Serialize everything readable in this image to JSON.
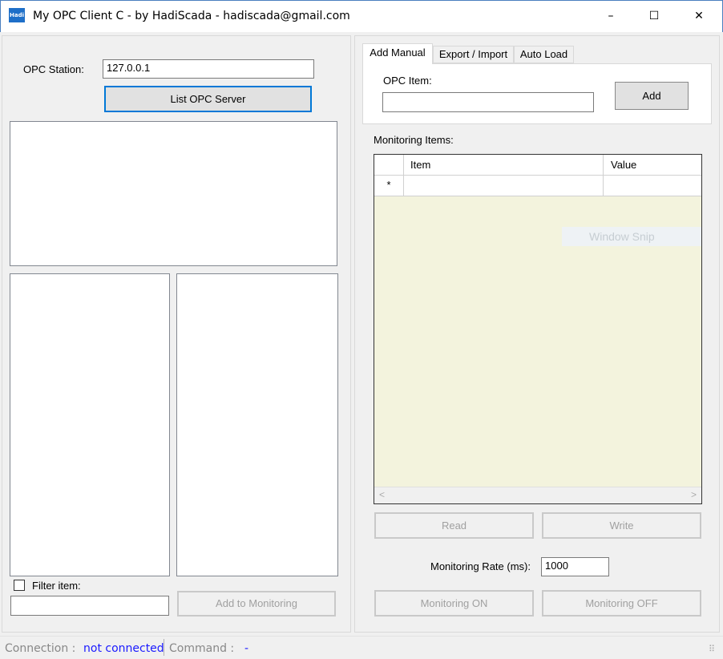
{
  "window": {
    "title": "My OPC Client C - by HadiScada - hadiscada@gmail.com",
    "icon_text": "Hadi",
    "minimize": "–",
    "maximize": "☐",
    "close": "✕"
  },
  "left": {
    "station_label": "OPC Station:",
    "station_value": "127.0.0.1",
    "list_button": "List OPC Server",
    "filter_label": "Filter item:",
    "filter_value": "",
    "add_button": "Add to Monitoring"
  },
  "tabs": [
    "Add Manual",
    "Export / Import",
    "Auto Load"
  ],
  "manual": {
    "opc_item_label": "OPC Item:",
    "opc_item_value": "",
    "add_button": "Add"
  },
  "monitoring": {
    "label": "Monitoring Items:",
    "columns": [
      "Item",
      "Value"
    ],
    "new_row_marker": "*",
    "read_button": "Read",
    "write_button": "Write",
    "rate_label": "Monitoring Rate (ms):",
    "rate_value": "1000",
    "on_button": "Monitoring ON",
    "off_button": "Monitoring OFF",
    "overlay": "Window Snip",
    "scroll_left": "<",
    "scroll_right": ">"
  },
  "status": {
    "connection_label": "Connection :",
    "connection_value": "not connected",
    "command_label": "Command :",
    "command_value": "-",
    "grip": "⠿"
  }
}
